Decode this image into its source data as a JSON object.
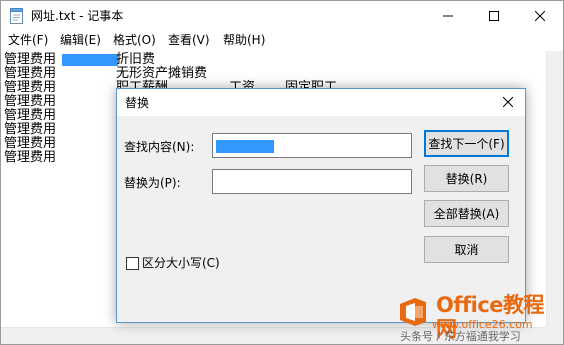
{
  "window": {
    "title": "网址.txt - 记事本"
  },
  "menu": [
    "文件(F)",
    "编辑(E)",
    "格式(O)",
    "查看(V)",
    "帮助(H)"
  ],
  "editor": {
    "lines": [
      {
        "a": "管理费用",
        "b": "折旧费",
        "c": "",
        "d": ""
      },
      {
        "a": "管理费用",
        "b": "无形资产摊销费",
        "c": "",
        "d": ""
      },
      {
        "a": "管理费用",
        "b": "职工薪酬",
        "c": "工资",
        "d": "固定职工"
      },
      {
        "a": "管理费用",
        "b": "",
        "c": "",
        "d": ""
      },
      {
        "a": "管理费用",
        "b": "",
        "c": "",
        "d": ""
      },
      {
        "a": "管理费用",
        "b": "",
        "c": "",
        "d": ""
      },
      {
        "a": "管理费用",
        "b": "",
        "c": "",
        "d": ""
      },
      {
        "a": "管理费用",
        "b": "",
        "c": "",
        "d": ""
      }
    ],
    "selection_color": "#3399ff"
  },
  "dialog": {
    "title": "替换",
    "find_label": "查找内容(N):",
    "find_value": "",
    "replace_label": "替换为(P):",
    "replace_value": "",
    "buttons": {
      "find_next": "查找下一个(F)",
      "replace": "替换(R)",
      "replace_all": "全部替换(A)",
      "cancel": "取消"
    },
    "match_case_label": "区分大小写(C)",
    "match_case_checked": false
  },
  "watermark": {
    "brand": "Office教程网",
    "url": "www.office26.com",
    "bottom_text": "头条号 / 东方福通我学习"
  },
  "colors": {
    "accent": "#0078d7",
    "watermark": "#e86a10"
  }
}
